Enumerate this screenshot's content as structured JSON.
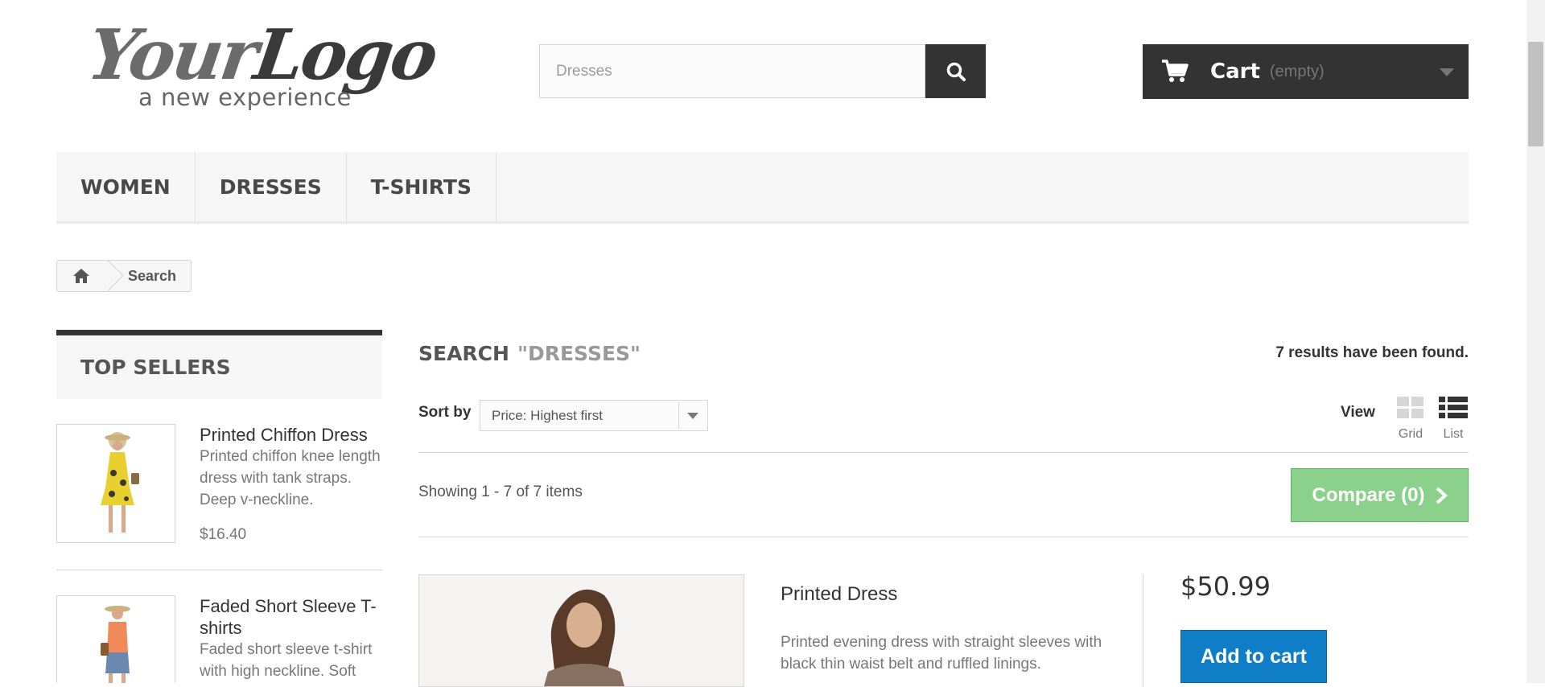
{
  "header": {
    "logo_text_main": "YourLogo",
    "logo_text_sub": "a new experience",
    "search": {
      "value": "",
      "placeholder": "Dresses"
    },
    "cart": {
      "title": "Cart",
      "status": "(empty)"
    }
  },
  "menu": [
    {
      "label": "WOMEN"
    },
    {
      "label": "DRESSES"
    },
    {
      "label": "T-SHIRTS"
    }
  ],
  "breadcrumb": {
    "current": "Search"
  },
  "sidebar": {
    "title": "TOP SELLERS",
    "items": [
      {
        "name": "Printed Chiffon Dress",
        "description": "Printed chiffon knee length dress with tank straps. Deep v-neckline.",
        "price": "$16.40"
      },
      {
        "name": "Faded Short Sleeve T-shirts",
        "description": "Faded short sleeve t-shirt with high neckline. Soft"
      }
    ]
  },
  "main": {
    "heading": "SEARCH",
    "query": "\"DRESSES\"",
    "results_text": "7 results have been found.",
    "sort_label": "Sort by",
    "sort_value": "Price: Highest first",
    "view_label": "View",
    "view_grid": "Grid",
    "view_list": "List",
    "showing": "Showing 1 - 7 of 7 items",
    "compare": "Compare (0)",
    "product": {
      "name": "Printed Dress",
      "description": "Printed evening dress with straight sleeves with black thin waist belt and ruffled linings.",
      "price": "$50.99",
      "add_to_cart": "Add to cart"
    }
  },
  "colors": {
    "dark": "#333333",
    "compare_green": "#8bd18b",
    "add_to_cart_blue": "#0f7ec6",
    "menu_bg": "#f6f6f6"
  },
  "icons": [
    "search-icon",
    "cart-icon",
    "chevron-down-icon",
    "home-icon",
    "grid-view-icon",
    "list-view-icon",
    "chevron-right-icon"
  ]
}
